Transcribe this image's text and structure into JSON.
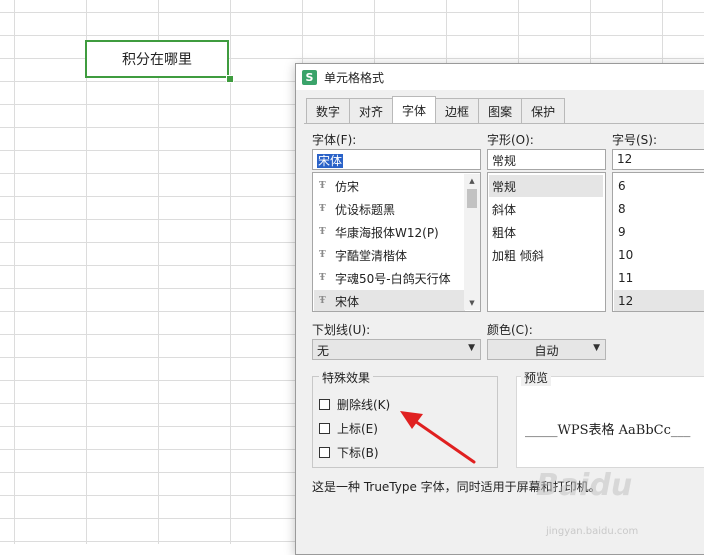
{
  "sheet": {
    "active_cell_text": "积分在哪里"
  },
  "dialog": {
    "title": "单元格格式",
    "tabs": [
      {
        "label": "数字"
      },
      {
        "label": "对齐"
      },
      {
        "label": "字体",
        "active": true
      },
      {
        "label": "边框"
      },
      {
        "label": "图案"
      },
      {
        "label": "保护"
      }
    ],
    "font": {
      "label": "字体(F):",
      "value": "宋体",
      "list": [
        "仿宋",
        "优设标题黑",
        "华康海报体W12(P)",
        "字酷堂清楷体",
        "字魂50号-白鸽天行体",
        "宋体"
      ],
      "selected": "宋体"
    },
    "style": {
      "label": "字形(O):",
      "value": "常规",
      "list": [
        "常规",
        "斜体",
        "粗体",
        "加粗 倾斜"
      ],
      "selected": "常规"
    },
    "size": {
      "label": "字号(S):",
      "value": "12",
      "list": [
        "6",
        "8",
        "9",
        "10",
        "11",
        "12"
      ],
      "selected": "12"
    },
    "underline": {
      "label": "下划线(U):",
      "value": "无"
    },
    "color": {
      "label": "颜色(C):",
      "value": "自动"
    },
    "effects": {
      "title": "特殊效果",
      "items": [
        {
          "label": "删除线(K)",
          "checked": false
        },
        {
          "label": "上标(E)",
          "checked": false
        },
        {
          "label": "下标(B)",
          "checked": false
        }
      ]
    },
    "preview": {
      "title": "预览",
      "text": "_____WPS表格  AaBbCc___"
    },
    "description": "这是一种 TrueType 字体，同时适用于屏幕和打印机。"
  },
  "colors": {
    "accent": "#3f9c3f",
    "annotation": "#e02020",
    "selection": "#2a62c8"
  },
  "watermark": {
    "text": "Baidu",
    "sub": "jingyan.baidu.com"
  }
}
